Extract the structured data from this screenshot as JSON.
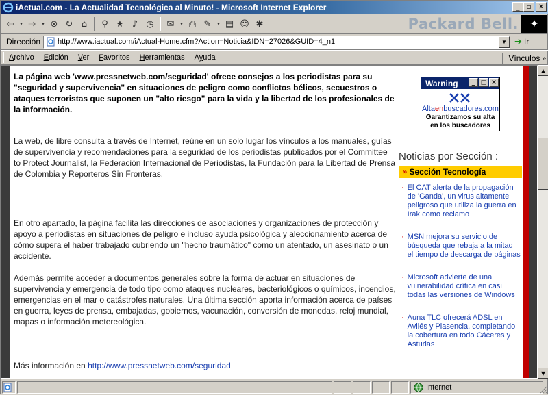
{
  "window": {
    "title": "iActual.com - La Actualidad Tecnológica al Minuto! - Microsoft Internet Explorer"
  },
  "toolbar": {
    "brand": "Packard Bell."
  },
  "address": {
    "label": "Dirección",
    "url": "http://www.iactual.com/iActual-Home.cfm?Action=Noticia&IDN=27026&GUID=4_n1",
    "go_label": "Ir"
  },
  "menu": {
    "items": [
      "Archivo",
      "Edición",
      "Ver",
      "Favoritos",
      "Herramientas",
      "Ayuda"
    ],
    "accel": [
      "A",
      "E",
      "V",
      "F",
      "H",
      "y"
    ],
    "links_label": "Vínculos"
  },
  "article": {
    "lead": "La página web 'www.pressnetweb.com/seguridad' ofrece consejos a los periodistas para su \"seguridad y supervivencia\" en situaciones de peligro como conflictos bélicos, secuestros o ataques terroristas que suponen un \"alto riesgo\" para la vida y la libertad de los profesionales de la información.",
    "p1": "La web, de libre consulta a través de Internet, reúne en un solo lugar los vínculos a los manuales, guías de supervivencia y recomendaciones para la seguridad de los periodistas publicados por el Committee to Protect Journalist, la Federación Internacional de Periodistas, la Fundación para la Libertad de Prensa de Colombia y Reporteros Sin Fronteras.",
    "p2": "En otro apartado, la página facilita las direcciones de asociaciones y organizaciones de protección y apoyo a periodistas en situaciones de peligro e incluso ayuda psicológica y aleccionamiento acerca de cómo supera el haber trabajado cubriendo un \"hecho traumático\" como un atentado, un asesinato o un accidente.",
    "p3": "Además permite acceder a documentos generales sobre la forma de actuar en situaciones de supervivencia y emergencia de todo tipo como ataques nucleares, bacteriológicos o químicos, incendios, emergencias en el mar o catástrofes naturales. Una última sección aporta información acerca de países en guerra, leyes de prensa, embajadas, gobiernos, vacunación, conversión de monedas, reloj mundial, mapas o información metereológica.",
    "more_label": "Más información en",
    "more_link": "http://www.pressnetweb.com/seguridad"
  },
  "ad": {
    "title": "Warning",
    "site_pre": "Alta",
    "site_mid": "en",
    "site_post": "buscadores.com",
    "text": "Garantizamos su alta en los buscadores"
  },
  "sidebar": {
    "heading": "Noticias por Sección :",
    "section": "Sección Tecnología",
    "news": [
      "El CAT alerta de la propagación de 'Ganda', un virus altamente peligroso que utiliza la guerra en Irak como reclamo",
      "MSN mejora su servicio de búsqueda que rebaja a la mitad el tiempo de descarga de páginas",
      "Microsoft advierte de una vulnerabilidad crítica en casi todas las versiones de Windows",
      "Auna TLC ofrecerá ADSL en Avilés y Plasencia, completando la cobertura en todo Cáceres y Asturias"
    ]
  },
  "status": {
    "zone": "Internet"
  }
}
